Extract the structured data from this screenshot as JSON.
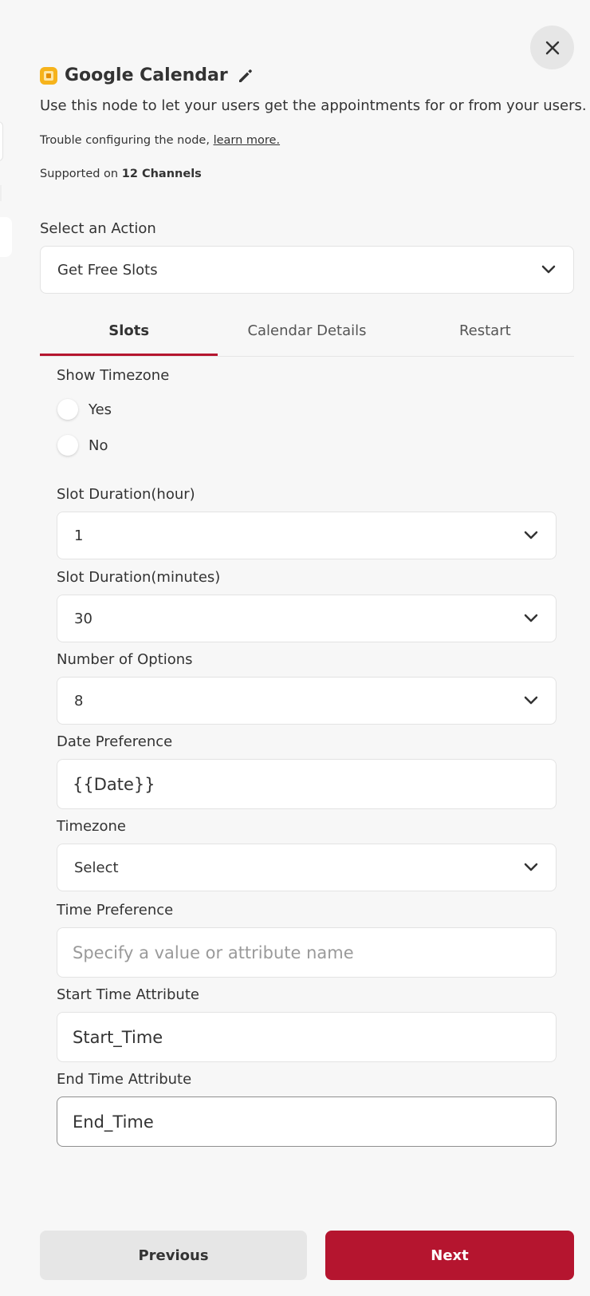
{
  "header": {
    "title": "Google Calendar",
    "description": "Use this node to let your users get the appointments for or from your users.",
    "trouble_prefix": "Trouble configuring the node,",
    "learn_more": "learn more.",
    "supported_prefix": "Supported on",
    "channels": "12 Channels"
  },
  "action": {
    "label": "Select an Action",
    "value": "Get Free Slots"
  },
  "tabs": [
    {
      "label": "Slots",
      "active": true
    },
    {
      "label": "Calendar Details",
      "active": false
    },
    {
      "label": "Restart",
      "active": false
    }
  ],
  "fields": {
    "show_timezone": {
      "label": "Show Timezone",
      "options": [
        "Yes",
        "No"
      ]
    },
    "slot_hour": {
      "label": "Slot Duration(hour)",
      "value": "1"
    },
    "slot_minutes": {
      "label": "Slot Duration(minutes)",
      "value": "30"
    },
    "num_options": {
      "label": "Number of Options",
      "value": "8"
    },
    "date_pref": {
      "label": "Date Preference",
      "value": "{{Date}}"
    },
    "timezone": {
      "label": "Timezone",
      "value": "Select"
    },
    "time_pref": {
      "label": "Time Preference",
      "placeholder": "Specify a value or attribute name"
    },
    "start_attr": {
      "label": "Start Time Attribute",
      "value": "Start_Time"
    },
    "end_attr": {
      "label": "End Time Attribute",
      "value": "End_Time"
    }
  },
  "buttons": {
    "previous": "Previous",
    "next": "Next"
  },
  "colors": {
    "accent": "#b5152f",
    "icon": "#f6b31b"
  }
}
